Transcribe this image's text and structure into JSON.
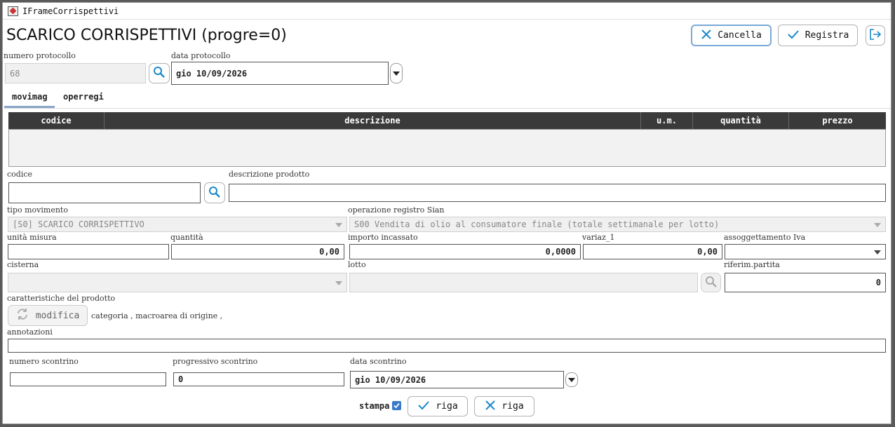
{
  "window": {
    "title": "IFrameCorrispettivi"
  },
  "page": {
    "heading": "SCARICO CORRISPETTIVI (progre=0)"
  },
  "toolbar": {
    "cancel_label": "Cancella",
    "save_label": "Registra"
  },
  "protocol": {
    "number_label": "numero protocollo",
    "number_value": "68",
    "date_label": "data protocollo",
    "date_value": "gio 10/09/2026"
  },
  "tabs": [
    {
      "label": "movimag"
    },
    {
      "label": "operregi"
    }
  ],
  "grid": {
    "columns": [
      "codice",
      "descrizione",
      "u.m.",
      "quantità",
      "prezzo"
    ]
  },
  "form": {
    "codice_label": "codice",
    "codice_value": "",
    "descrizione_label": "descrizione prodotto",
    "descrizione_value": "",
    "tipo_label": "tipo movimento",
    "tipo_value": "[S0] SCARICO CORRISPETTIVO",
    "operazione_label": "operazione registro Sian",
    "operazione_value": "S00   Vendita di olio al consumatore finale (totale settimanale per lotto)",
    "unita_label": "unità misura",
    "unita_value": "",
    "quantita_label": "quantità",
    "quantita_value": "0,00",
    "importo_label": "importo incassato",
    "importo_value": "0,0000",
    "variaz_label": "variaz_1",
    "variaz_value": "0,00",
    "iva_label": "assoggettamento Iva",
    "iva_value": "",
    "cisterna_label": "cisterna",
    "cisterna_value": "",
    "lotto_label": "lotto",
    "lotto_value": "",
    "partita_label": "riferim.partita",
    "partita_value": "0",
    "caratteristiche_label": "caratteristiche del prodotto",
    "modifica_label": "modifica",
    "caratteristiche_text": "categoria ,  macroarea di origine ,",
    "annotazioni_label": "annotazioni",
    "annotazioni_value": "",
    "scontrino_num_label": "numero scontrino",
    "scontrino_num_value": "",
    "scontrino_prog_label": "progressivo scontrino",
    "scontrino_prog_value": "0",
    "scontrino_data_label": "data scontrino",
    "scontrino_data_value": "gio 10/09/2026"
  },
  "footer": {
    "stampa_label": "stampa",
    "confirm_row_label": "riga",
    "delete_row_label": "riga"
  },
  "colors": {
    "accent": "#1a88c9",
    "header_bg": "#3a3a3a",
    "focus_border": "#7aa9d8"
  }
}
